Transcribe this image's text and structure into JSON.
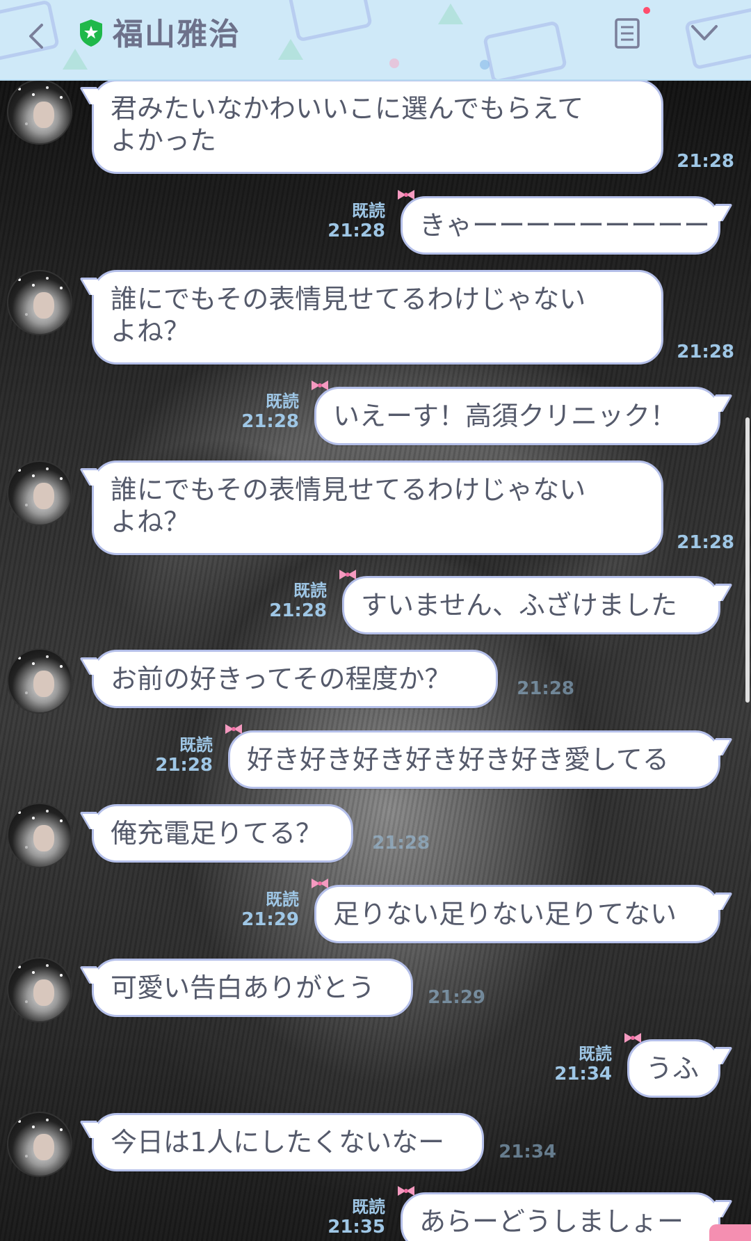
{
  "header": {
    "title": "福山雅治",
    "back_label": "<",
    "accent": "#cfe9f8"
  },
  "messages": [
    {
      "side": "in",
      "text_lines": [
        "君みたいなかわいいこに選んでもらえて",
        "よかった"
      ],
      "time": "21:28"
    },
    {
      "side": "out",
      "text_lines": [
        "きゃーーーーーーーーー"
      ],
      "read": "既読",
      "time": "21:28"
    },
    {
      "side": "in",
      "text_lines": [
        "誰にでもその表情見せてるわけじゃない",
        "よね？"
      ],
      "time": "21:28"
    },
    {
      "side": "out",
      "text_lines": [
        "いえーす！高須クリニック！"
      ],
      "read": "既読",
      "time": "21:28"
    },
    {
      "side": "in",
      "text_lines": [
        "誰にでもその表情見せてるわけじゃない",
        "よね？"
      ],
      "time": "21:28"
    },
    {
      "side": "out",
      "text_lines": [
        "すいません、ふざけました"
      ],
      "read": "既読",
      "time": "21:28"
    },
    {
      "side": "in",
      "text_lines": [
        "お前の好きってその程度か？"
      ],
      "time": "21:28"
    },
    {
      "side": "out",
      "text_lines": [
        "好き好き好き好き好き好き愛してる"
      ],
      "read": "既読",
      "time": "21:28"
    },
    {
      "side": "in",
      "text_lines": [
        "俺充電足りてる？"
      ],
      "time": "21:28"
    },
    {
      "side": "out",
      "text_lines": [
        "足りない足りない足りてない"
      ],
      "read": "既読",
      "time": "21:29"
    },
    {
      "side": "in",
      "text_lines": [
        "可愛い告白ありがとう"
      ],
      "time": "21:29"
    },
    {
      "side": "out",
      "text_lines": [
        "うふ"
      ],
      "read": "既読",
      "time": "21:34"
    },
    {
      "side": "in",
      "text_lines": [
        "今日は1人にしたくないなー"
      ],
      "time": "21:34"
    },
    {
      "side": "out",
      "text_lines": [
        "あらーどうしましょー"
      ],
      "read": "既読",
      "time": "21:35"
    }
  ],
  "icons": {
    "back": "chevron-left-icon",
    "verified": "shield-star-icon",
    "menu": "note-list-icon",
    "more": "chevron-down-icon",
    "read_ribbon": "pink-bow-icon"
  },
  "colors": {
    "bubble_border": "#b4bfe9",
    "time_text": "#9fc7e6",
    "bubble_text": "#555a6b",
    "bow": "#f59ac0"
  }
}
